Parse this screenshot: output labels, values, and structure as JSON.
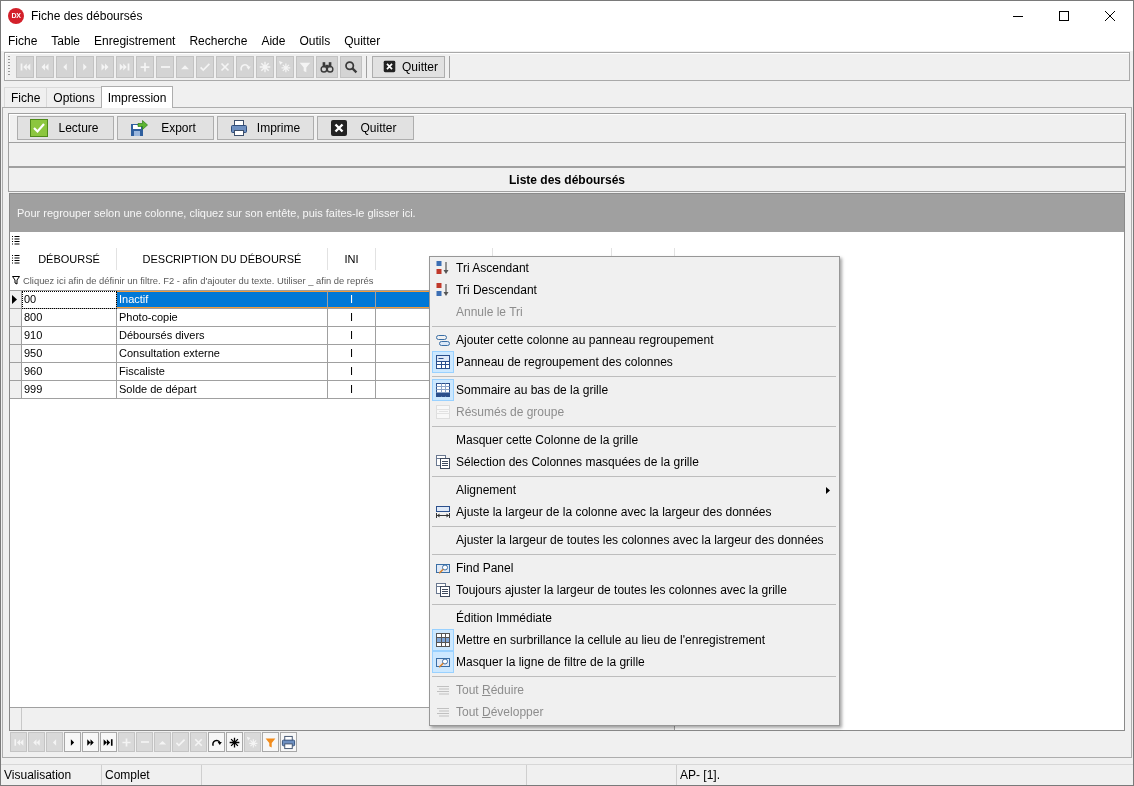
{
  "window": {
    "logo": "DX",
    "title": "Fiche des déboursés"
  },
  "menu_bar": [
    "Fiche",
    "Table",
    "Enregistrement",
    "Recherche",
    "Aide",
    "Outils",
    "Quitter"
  ],
  "toolbar": {
    "buttons": [
      {
        "disabled": true
      },
      {
        "disabled": true
      },
      {
        "disabled": true
      },
      {
        "disabled": true
      },
      {
        "disabled": true
      },
      {
        "disabled": true
      },
      {
        "disabled": true
      },
      {
        "disabled": true
      },
      {
        "disabled": true
      },
      {
        "disabled": true
      },
      {
        "disabled": true
      },
      {
        "disabled": true
      },
      {
        "disabled": true
      },
      {
        "disabled": true
      },
      {
        "disabled": true
      },
      {
        "disabled": false
      },
      {
        "disabled": false
      }
    ],
    "quit_button": "Quitter"
  },
  "tabs": [
    {
      "label": "Fiche",
      "selected": false
    },
    {
      "label": "Options",
      "selected": false
    },
    {
      "label": "Impression",
      "selected": true
    }
  ],
  "actions": [
    "Lecture",
    "Export",
    "Imprime",
    "Quitter"
  ],
  "list_title": "Liste des déboursés",
  "grid": {
    "group_panel_hint": "Pour regrouper selon une colonne, cliquez sur son entête, puis faites-le glisser ici.",
    "columns": [
      "DÉBOURSÉ",
      "DESCRIPTION DU DÉBOURSÉ",
      "INI"
    ],
    "filter_row": {
      "placeholder": "Cliquez ici afin de définir un filtre. F2 - afin d'ajouter du texte. Utiliser _ afin de représ"
    },
    "rows": [
      {
        "cells": [
          "00",
          "Inactif",
          "I"
        ],
        "selected": true
      },
      {
        "cells": [
          "800",
          "Photo-copie",
          "I"
        ],
        "selected": false
      },
      {
        "cells": [
          "910",
          "Déboursés divers",
          "I"
        ],
        "selected": false
      },
      {
        "cells": [
          "950",
          "Consultation externe",
          "I"
        ],
        "selected": false
      },
      {
        "cells": [
          "960",
          "Fiscaliste",
          "I"
        ],
        "selected": false
      },
      {
        "cells": [
          "999",
          "Solde de départ",
          "I"
        ],
        "selected": false
      }
    ]
  },
  "navigator": {
    "buttons": [
      {
        "disabled": true
      },
      {
        "disabled": true
      },
      {
        "disabled": true
      },
      {
        "disabled": false
      },
      {
        "disabled": false
      },
      {
        "disabled": false
      },
      {
        "disabled": true
      },
      {
        "disabled": true
      },
      {
        "disabled": true
      },
      {
        "disabled": true
      },
      {
        "disabled": true
      },
      {
        "disabled": false
      },
      {
        "disabled": false
      },
      {
        "disabled": true
      },
      {
        "disabled": false
      },
      {
        "disabled": false
      }
    ]
  },
  "context_menu": {
    "groups": [
      [
        {
          "label": "Tri Ascendant",
          "checked": false,
          "disabled": false,
          "submenu": false
        },
        {
          "label": "Tri Descendant",
          "checked": false,
          "disabled": false,
          "submenu": false
        },
        {
          "label": "Annule le Tri",
          "checked": false,
          "disabled": true,
          "submenu": false
        }
      ],
      [
        {
          "label": "Ajouter cette colonne au panneau regroupement",
          "checked": false,
          "disabled": false,
          "submenu": false
        },
        {
          "label": "Panneau de regroupement des colonnes",
          "checked": true,
          "disabled": false,
          "submenu": false
        }
      ],
      [
        {
          "label": "Sommaire au bas de la grille",
          "checked": true,
          "disabled": false,
          "submenu": false
        },
        {
          "label": "Résumés de groupe",
          "checked": false,
          "disabled": true,
          "submenu": false
        }
      ],
      [
        {
          "label": "Masquer cette Colonne de la grille",
          "checked": false,
          "disabled": false,
          "submenu": false
        },
        {
          "label": "Sélection des Colonnes masquées de la grille",
          "checked": false,
          "disabled": false,
          "submenu": false
        }
      ],
      [
        {
          "label": "Alignement",
          "checked": false,
          "disabled": false,
          "submenu": true
        },
        {
          "label": "Ajuste la largeur de la colonne avec la largeur des données",
          "checked": false,
          "disabled": false,
          "submenu": false
        }
      ],
      [
        {
          "label": "Ajuster la largeur de toutes les colonnes avec la largeur des données",
          "checked": false,
          "disabled": false,
          "submenu": false
        }
      ],
      [
        {
          "label": "Find Panel",
          "checked": false,
          "disabled": false,
          "submenu": false
        },
        {
          "label": "Toujours ajuster la largeur de toutes les colonnes avec la grille",
          "checked": false,
          "disabled": false,
          "submenu": false
        }
      ],
      [
        {
          "label": "Édition Immédiate",
          "checked": false,
          "disabled": false,
          "submenu": false
        },
        {
          "label": "Mettre en surbrillance la cellule au lieu de l'enregistrement",
          "checked": true,
          "disabled": false,
          "submenu": false
        },
        {
          "label": "Masquer la ligne de filtre de la grille",
          "checked": true,
          "disabled": false,
          "submenu": false
        }
      ],
      [
        {
          "label": "Tout ",
          "accel": "R",
          "label_rest": "éduire",
          "checked": false,
          "disabled": true,
          "submenu": false
        },
        {
          "label": "Tout ",
          "accel": "D",
          "label_rest": "évelopper",
          "checked": false,
          "disabled": true,
          "submenu": false
        }
      ]
    ]
  },
  "status_bar": {
    "panels": [
      "Visualisation",
      "Complet"
    ],
    "info": "AP- [1]."
  }
}
